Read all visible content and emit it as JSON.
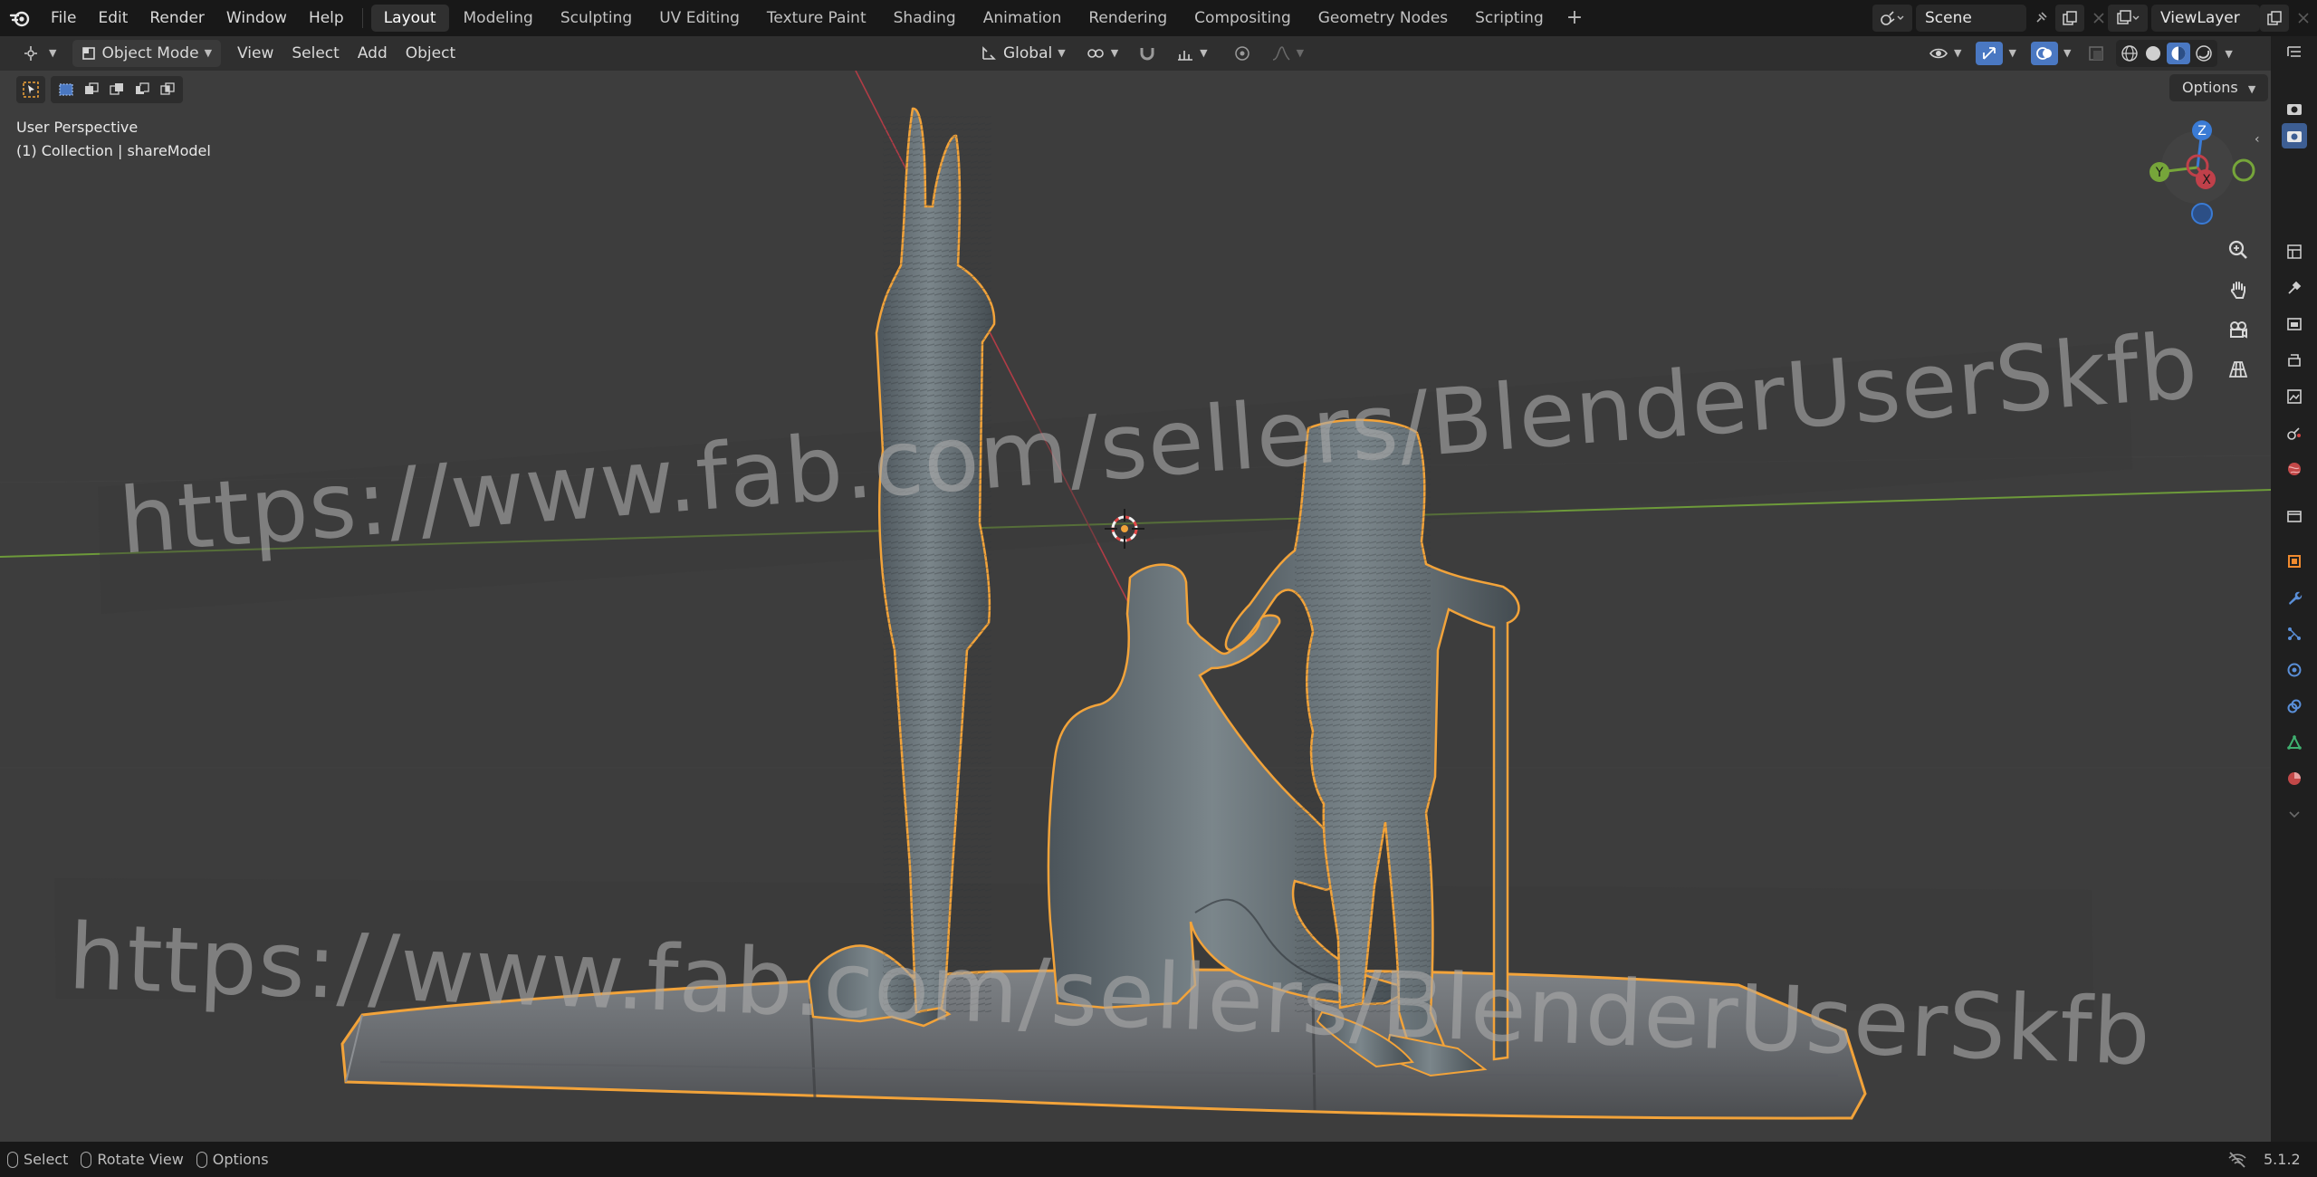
{
  "topbar": {
    "menus": [
      "File",
      "Edit",
      "Render",
      "Window",
      "Help"
    ],
    "workspaces": [
      "Layout",
      "Modeling",
      "Sculpting",
      "UV Editing",
      "Texture Paint",
      "Shading",
      "Animation",
      "Rendering",
      "Compositing",
      "Geometry Nodes",
      "Scripting"
    ],
    "active_workspace": "Layout",
    "add_workspace": "+",
    "scene_name": "Scene",
    "view_layer_name": "ViewLayer"
  },
  "viewport_header": {
    "mode": "Object Mode",
    "menus": [
      "View",
      "Select",
      "Add",
      "Object"
    ],
    "transform_orientation": "Global"
  },
  "viewport": {
    "perspective_label": "User Perspective",
    "collection_label": "(1) Collection | shareModel",
    "options_label": "Options",
    "watermark_text": "https://www.fab.com/sellers/BlenderUserSkfb",
    "gizmo": {
      "z": "Z",
      "y": "Y",
      "x": "X"
    },
    "colors": {
      "background": "#3d3d3d",
      "selection_outline": "#f2a33a",
      "x_axis": "#c0404a",
      "y_axis": "#76a53a",
      "z_axis": "#3a7bd5"
    }
  },
  "statusbar": {
    "items": [
      "Select",
      "Rotate View",
      "Options"
    ],
    "version": "5.1.2"
  }
}
